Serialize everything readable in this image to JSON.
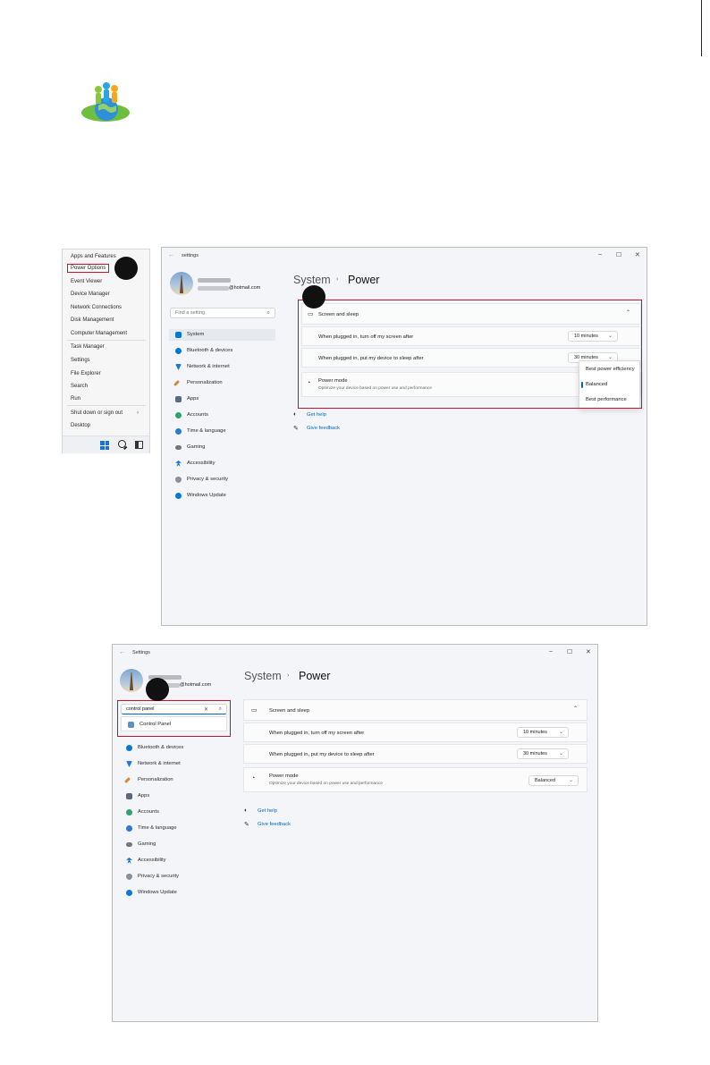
{
  "winx_menu": {
    "items": [
      "Apps and Features",
      "Power Options",
      "Event Viewer",
      "Device Manager",
      "Network Connections",
      "Disk Management",
      "Computer Management",
      "Task Manager",
      "Settings",
      "File Explorer",
      "Search",
      "Run",
      "Shut down or sign out",
      "Desktop"
    ]
  },
  "settings_top": {
    "title": "settings",
    "email": "@hotmail.com",
    "search_placeholder": "Find a setting",
    "nav": [
      "System",
      "Bluetooth & devices",
      "Network & internet",
      "Personalization",
      "Apps",
      "Accounts",
      "Time & language",
      "Gaming",
      "Accessibility",
      "Privacy & security",
      "Windows Update"
    ],
    "crumb_parent": "System",
    "crumb_current": "Power",
    "screen_sleep": "Screen and sleep",
    "screen_off_label": "When plugged in, turn off my screen after",
    "screen_off_value": "10 minutes",
    "sleep_label": "When plugged in, put my device to sleep after",
    "sleep_value": "30 minutes",
    "power_mode": "Power mode",
    "power_mode_sub": "Optimize your device based on power use and performance",
    "power_mode_options": [
      "Best power efficiency",
      "Balanced",
      "Best performance"
    ],
    "get_help": "Get help",
    "give_feedback": "Give feedback"
  },
  "settings_bottom": {
    "title": "Settings",
    "email": "@hotmail.com",
    "search_value": "control panel",
    "search_result": "Control Panel",
    "nav": [
      "Bluetooth & devices",
      "Network & internet",
      "Personalization",
      "Apps",
      "Accounts",
      "Time & language",
      "Gaming",
      "Accessibility",
      "Privacy & security",
      "Windows Update"
    ],
    "crumb_parent": "System",
    "crumb_current": "Power",
    "screen_sleep": "Screen and sleep",
    "screen_off_label": "When plugged in, turn off my screen after",
    "screen_off_value": "10 minutes",
    "sleep_label": "When plugged in, put my device to sleep after",
    "sleep_value": "30 minutes",
    "power_mode": "Power mode",
    "power_mode_sub": "Optimize your device based on power use and performance",
    "power_mode_value": "Balanced",
    "get_help": "Get help",
    "give_feedback": "Give feedback"
  },
  "colors": {
    "highlight": "#c8102e",
    "accent": "#0067c0"
  }
}
